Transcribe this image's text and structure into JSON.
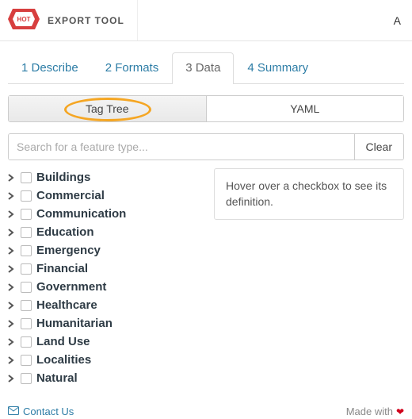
{
  "header": {
    "brand": "EXPORT TOOL",
    "right_menu": "A"
  },
  "steps": [
    {
      "label": "1 Describe",
      "active": false
    },
    {
      "label": "2 Formats",
      "active": false
    },
    {
      "label": "3 Data",
      "active": true
    },
    {
      "label": "4 Summary",
      "active": false
    }
  ],
  "subtabs": {
    "tag_tree": "Tag Tree",
    "yaml": "YAML",
    "active": "tag_tree"
  },
  "search": {
    "placeholder": "Search for a feature type...",
    "value": "",
    "clear_label": "Clear"
  },
  "hint": "Hover over a checkbox to see its definition.",
  "tree": [
    "Buildings",
    "Commercial",
    "Communication",
    "Education",
    "Emergency",
    "Financial",
    "Government",
    "Healthcare",
    "Humanitarian",
    "Land Use",
    "Localities",
    "Natural"
  ],
  "footer": {
    "contact": "Contact Us",
    "made_with": "Made with"
  }
}
